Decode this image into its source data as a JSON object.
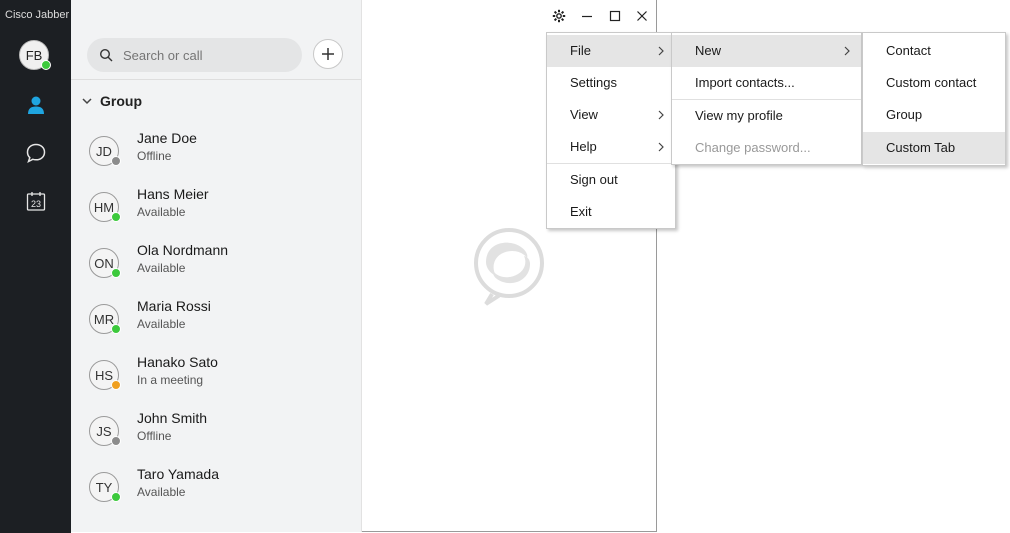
{
  "app": {
    "title": "Cisco Jabber"
  },
  "user": {
    "initials": "FB",
    "status_color": "#3cc93c"
  },
  "rail": {
    "calendar_day": "23"
  },
  "search": {
    "placeholder": "Search or call"
  },
  "group": {
    "name": "Group"
  },
  "contacts": [
    {
      "initials": "JD",
      "name": "Jane Doe",
      "status": "Offline",
      "status_color": "#8c8c8c"
    },
    {
      "initials": "HM",
      "name": "Hans Meier",
      "status": "Available",
      "status_color": "#3cc93c"
    },
    {
      "initials": "ON",
      "name": "Ola Nordmann",
      "status": "Available",
      "status_color": "#3cc93c"
    },
    {
      "initials": "MR",
      "name": "Maria Rossi",
      "status": "Available",
      "status_color": "#3cc93c"
    },
    {
      "initials": "HS",
      "name": "Hanako Sato",
      "status": "In a meeting",
      "status_color": "#f0a020"
    },
    {
      "initials": "JS",
      "name": "John Smith",
      "status": "Offline",
      "status_color": "#8c8c8c"
    },
    {
      "initials": "TY",
      "name": "Taro Yamada",
      "status": "Available",
      "status_color": "#3cc93c"
    }
  ],
  "menu_main": {
    "items": [
      {
        "label": "File",
        "submenu": true
      },
      {
        "label": "Settings"
      },
      {
        "label": "View",
        "submenu": true
      },
      {
        "label": "Help",
        "submenu": true
      },
      {
        "label": "Sign out"
      },
      {
        "label": "Exit"
      }
    ]
  },
  "menu_file": {
    "items": [
      {
        "label": "New",
        "submenu": true
      },
      {
        "label": "Import contacts..."
      },
      {
        "label": "View my profile"
      },
      {
        "label": "Change password...",
        "disabled": true
      }
    ]
  },
  "menu_new": {
    "items": [
      {
        "label": "Contact"
      },
      {
        "label": "Custom contact"
      },
      {
        "label": "Group"
      },
      {
        "label": "Custom Tab"
      }
    ]
  },
  "colors": {
    "accent": "#1fa5e0",
    "rail_bg": "#1c1f23",
    "panel_bg": "#f2f3f4"
  }
}
